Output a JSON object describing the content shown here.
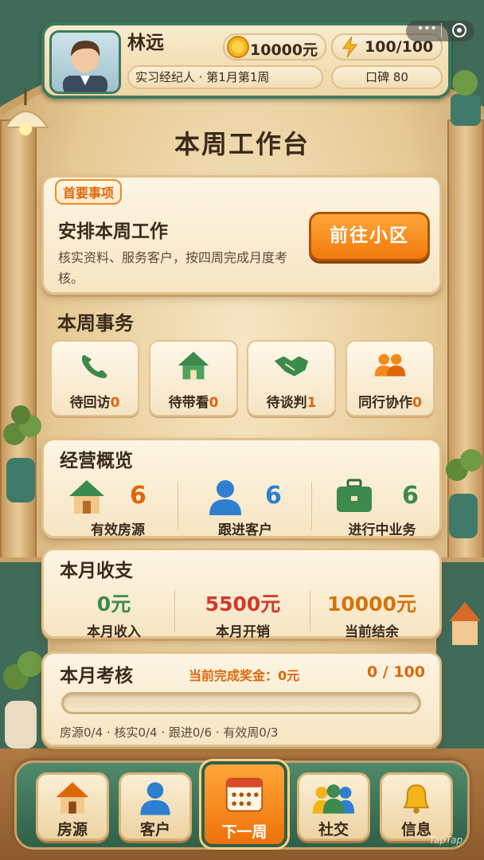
{
  "header": {
    "player_name": "林远",
    "role_status": "实习经纪人 · 第1月第1周",
    "coins": "10000元",
    "energy": "100/100",
    "reputation": "口碑 80",
    "menu_icons": [
      "more-icon",
      "record-icon"
    ]
  },
  "page_title": "本周工作台",
  "priority": {
    "tag": "首要事项",
    "heading": "安排本周工作",
    "description": "核实资料、服务客户，按四周完成月度考核。",
    "button": "前往小区"
  },
  "weekly_tasks": {
    "heading": "本周事务",
    "items": [
      {
        "label": "待回访",
        "count": "0",
        "icon": "phone-icon"
      },
      {
        "label": "待带看",
        "count": "0",
        "icon": "house-icon"
      },
      {
        "label": "待谈判",
        "count": "1",
        "icon": "handshake-icon"
      },
      {
        "label": "同行协作",
        "count": "0",
        "icon": "people-icon"
      }
    ]
  },
  "overview": {
    "heading": "经营概览",
    "items": [
      {
        "label": "有效房源",
        "value": "6",
        "color": "#e0660a",
        "icon": "house-icon"
      },
      {
        "label": "跟进客户",
        "value": "6",
        "color": "#2f7fd0",
        "icon": "person-icon"
      },
      {
        "label": "进行中业务",
        "value": "6",
        "color": "#3c8a4e",
        "icon": "briefcase-icon"
      }
    ]
  },
  "finance": {
    "heading": "本月收支",
    "items": [
      {
        "label": "本月收入",
        "value": "0元",
        "color": "#3c8a4e"
      },
      {
        "label": "本月开销",
        "value": "5500元",
        "color": "#d03a2a"
      },
      {
        "label": "当前结余",
        "value": "10000元",
        "color": "#d4720a"
      }
    ]
  },
  "assessment": {
    "heading": "本月考核",
    "bonus": "当前完成奖金：0元",
    "score": "0 / 100",
    "progress": 0,
    "criteria": "房源0/4 · 核实0/4 · 跟进0/6 · 有效周0/3"
  },
  "nav": {
    "items": [
      {
        "label": "房源",
        "icon": "house-icon"
      },
      {
        "label": "客户",
        "icon": "person-icon"
      },
      {
        "label": "下一周",
        "icon": "calendar-icon"
      },
      {
        "label": "社交",
        "icon": "group-icon"
      },
      {
        "label": "信息",
        "icon": "bell-icon"
      }
    ],
    "watermark": "TapTap"
  },
  "colors": {
    "accent": "#f27a0c",
    "frame": "#3f7a5e",
    "panel": "#fdf5e4"
  }
}
